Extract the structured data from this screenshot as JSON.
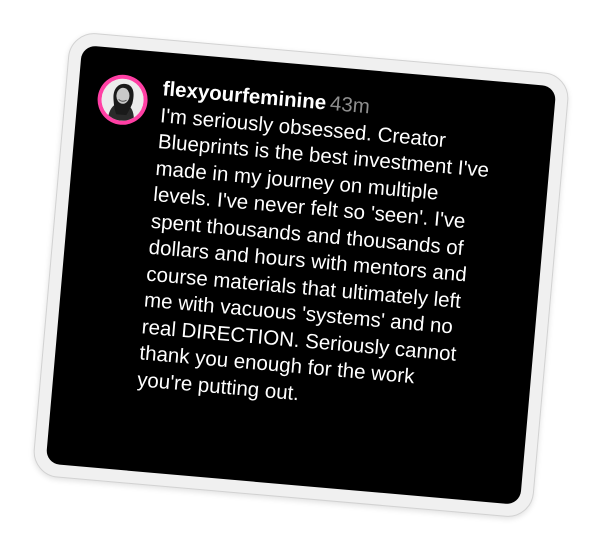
{
  "comment": {
    "username": "flexyourfeminine",
    "time": "43m",
    "lines": [
      "I'm seriously obsessed. Creator",
      "Blueprints is the best investment I've",
      "made in my journey on multiple",
      "levels. I've never felt so 'seen'. I've",
      "spent thousands and thousands of",
      "dollars and hours with mentors and",
      "course materials that ultimately left",
      "me with vacuous 'systems' and no",
      "real DIRECTION. Seriously cannot",
      "thank you enough for the work",
      "you're putting out."
    ]
  },
  "colors": {
    "card_background": "#000000",
    "frame": "#f0f0f0",
    "avatar_ring": "#ff3fa4",
    "text": "#ffffff",
    "timestamp": "#8e8e8e"
  },
  "icons": {
    "avatar": "profile-photo"
  }
}
